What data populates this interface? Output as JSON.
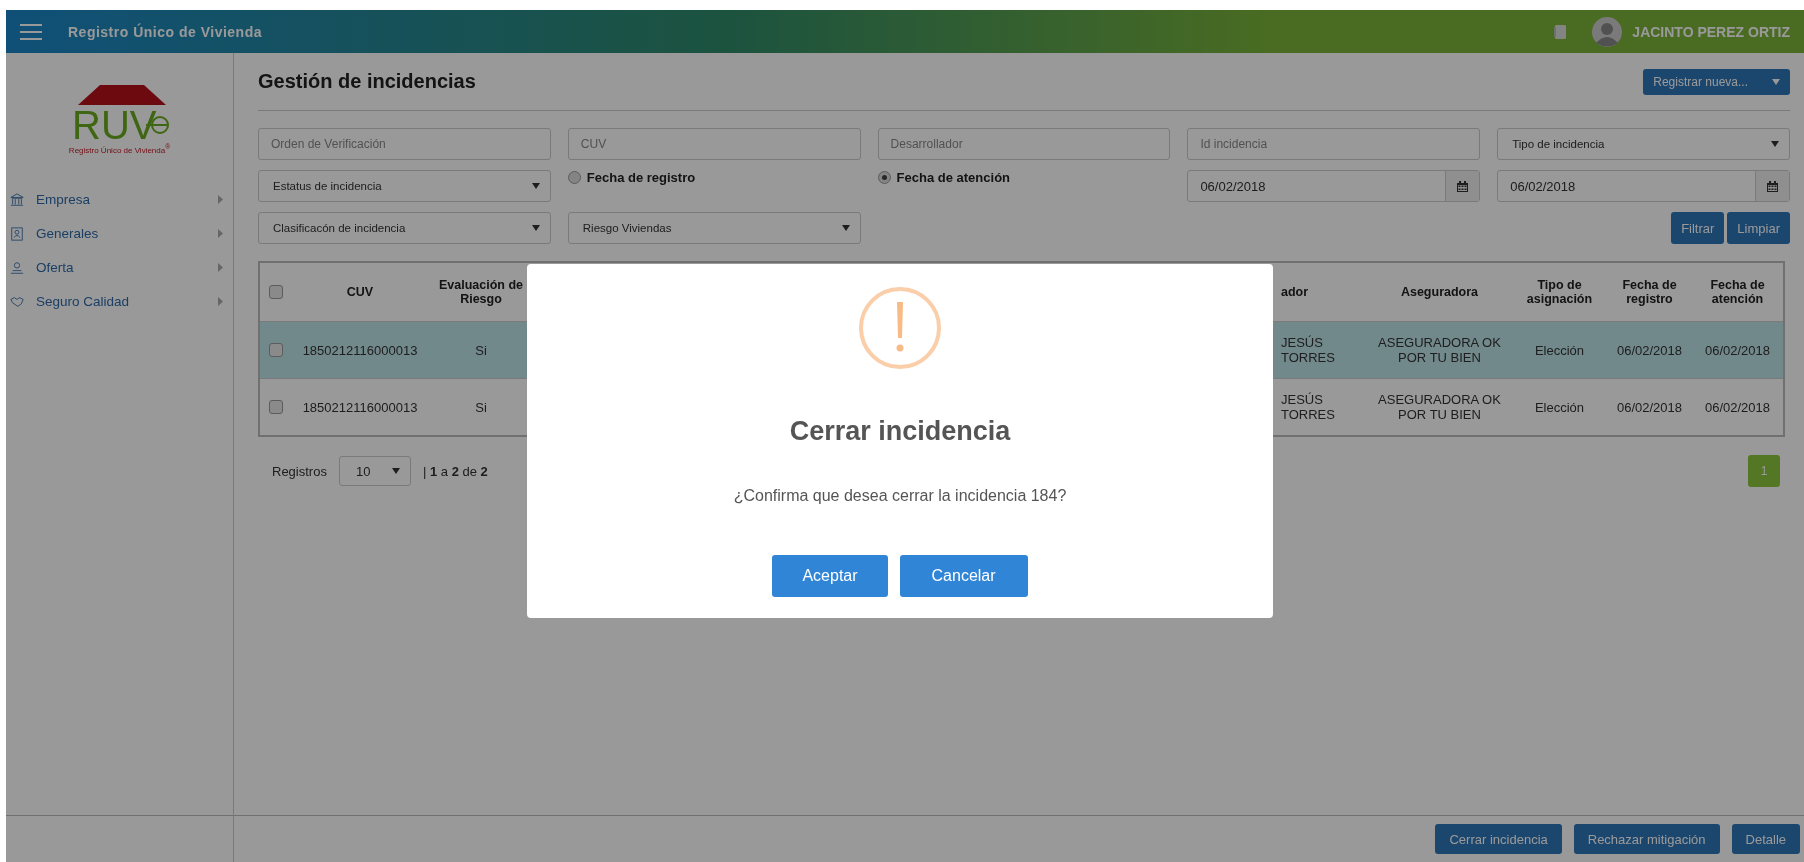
{
  "header": {
    "title": "Registro Único de Vivienda",
    "user": "JACINTO PEREZ ORTIZ"
  },
  "sidebar": {
    "logo_text": "RUV",
    "logo_caption": "Registro Único de Vivienda$^{®}$",
    "items": [
      {
        "label": "Empresa"
      },
      {
        "label": "Generales"
      },
      {
        "label": "Oferta"
      },
      {
        "label": "Seguro Calidad"
      }
    ]
  },
  "page": {
    "title": "Gestión de incidencias",
    "new_button": "Registrar nueva..."
  },
  "filters": [
    [
      {
        "kind": "input",
        "placeholder": "Orden de Verificación"
      },
      {
        "kind": "input",
        "placeholder": "CUV"
      },
      {
        "kind": "input",
        "placeholder": "Desarrollador"
      },
      {
        "kind": "input",
        "placeholder": "Id incidencia"
      },
      {
        "kind": "select",
        "value": "Tipo de incidencia"
      }
    ],
    [
      {
        "kind": "select",
        "value": "Estatus de incidencia"
      },
      {
        "kind": "radio",
        "label": "Fecha de registro",
        "selected": false
      },
      {
        "kind": "radio",
        "label": "Fecha de atención",
        "selected": true
      },
      {
        "kind": "date",
        "value": "06/02/2018"
      },
      {
        "kind": "date",
        "value": "06/02/2018"
      }
    ],
    [
      {
        "kind": "select",
        "value": "Clasificacón de incidencia"
      },
      {
        "kind": "select",
        "value": "Riesgo Viviendas"
      }
    ]
  ],
  "filter_buttons": [
    "Filtrar",
    "Limpiar"
  ],
  "table": {
    "all_checked": false,
    "columns": [
      "CUV",
      "Evaluación de Riesgo",
      "ador",
      "Aseguradora",
      "Tipo de asignación",
      "Fecha de registro",
      "Fecha de atención"
    ],
    "rows": [
      {
        "selected": true,
        "checked": false,
        "cells": [
          "1850212116000013",
          "Si",
          "JESÚS TORRES",
          "ASEGURADORA OK POR TU BIEN",
          "Elección",
          "06/02/2018",
          "06/02/2018"
        ]
      },
      {
        "selected": false,
        "checked": false,
        "cells": [
          "1850212116000013",
          "Si",
          "JESÚS TORRES",
          "ASEGURADORA OK POR TU BIEN",
          "Elección",
          "06/02/2018",
          "06/02/2018"
        ]
      }
    ]
  },
  "pagination": {
    "label": "Registros",
    "page_size": "10",
    "summary": "| **1** a **2** de **2**",
    "pages": [
      {
        "label": "1",
        "selected": true
      }
    ]
  },
  "footer_buttons": [
    "Cerrar incidencia",
    "Rechazar mitigación",
    "Detalle"
  ],
  "modal": {
    "title": "Cerrar incidencia",
    "message": "¿Confirma que desea cerrar la incidencia 184?",
    "buttons": [
      {
        "label": "Aceptar",
        "kind": "primary"
      },
      {
        "label": "Cancelar",
        "kind": "secondary"
      }
    ]
  }
}
